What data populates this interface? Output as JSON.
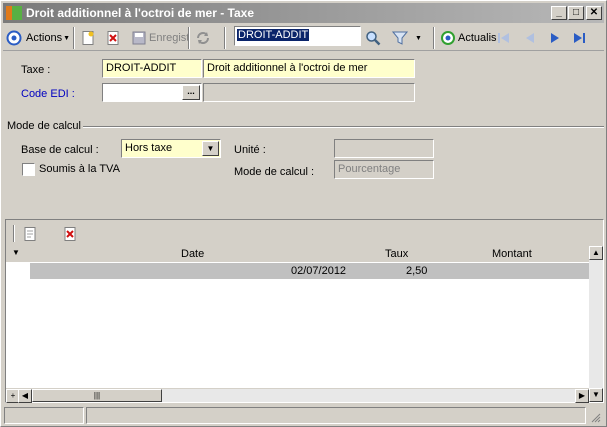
{
  "window": {
    "title": "Droit additionnel à l'octroi de mer -  Taxe",
    "controls": {
      "minimize": "_",
      "maximize": "□",
      "close": "✕"
    }
  },
  "toolbar": {
    "actions_label": "Actions",
    "save_label": "Enregist",
    "search_value": "DROIT-ADDIT",
    "refresh_label": "Actualis"
  },
  "form": {
    "taxe_label": "Taxe :",
    "taxe_code": "DROIT-ADDIT",
    "taxe_name": "Droit additionnel à l'octroi de mer",
    "code_edi_label": "Code EDI :",
    "code_edi_value": "",
    "code_edi_desc": "",
    "browse_label": "..."
  },
  "mode_calcul": {
    "group_title": "Mode de calcul",
    "base_label": "Base de calcul :",
    "base_value": "Hors taxe",
    "tva_label": "Soumis à la TVA",
    "tva_checked": false,
    "unite_label": "Unité :",
    "unite_value": "",
    "mode_label": "Mode de calcul :",
    "mode_value": "Pourcentage"
  },
  "grid": {
    "columns": [
      "Date",
      "Taux",
      "Montant"
    ],
    "rows": [
      {
        "date": "02/07/2012",
        "taux": "2,50",
        "montant": ""
      }
    ],
    "footer_add": "+"
  },
  "colors": {
    "required_field": "#ffffcc",
    "title_bar": "#7a7a7a",
    "link_label": "#0000c0",
    "selected_row": "#c0c0c0"
  }
}
